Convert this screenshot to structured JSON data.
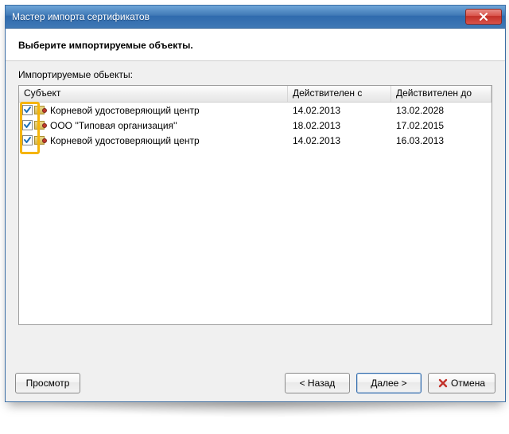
{
  "window": {
    "title": "Мастер импорта сертификатов"
  },
  "header": {
    "heading": "Выберите импортируемые объекты."
  },
  "section": {
    "label": "Импортируемые обьекты:"
  },
  "columns": {
    "subject": "Субъект",
    "valid_from": "Действителен с",
    "valid_to": "Действителен до"
  },
  "rows": [
    {
      "checked": true,
      "subject": "Корневой удостоверяющий центр",
      "valid_from": "14.02.2013",
      "valid_to": "13.02.2028"
    },
    {
      "checked": true,
      "subject": "ООО ''Типовая организация''",
      "valid_from": "18.02.2013",
      "valid_to": "17.02.2015"
    },
    {
      "checked": true,
      "subject": "Корневой удостоверяющий центр",
      "valid_from": "14.02.2013",
      "valid_to": "16.03.2013"
    }
  ],
  "buttons": {
    "view": "Просмотр",
    "back": "< Назад",
    "next": "Далее >",
    "cancel": "Отмена"
  },
  "icons": {
    "close": "close-icon",
    "cancel_x": "✖"
  }
}
